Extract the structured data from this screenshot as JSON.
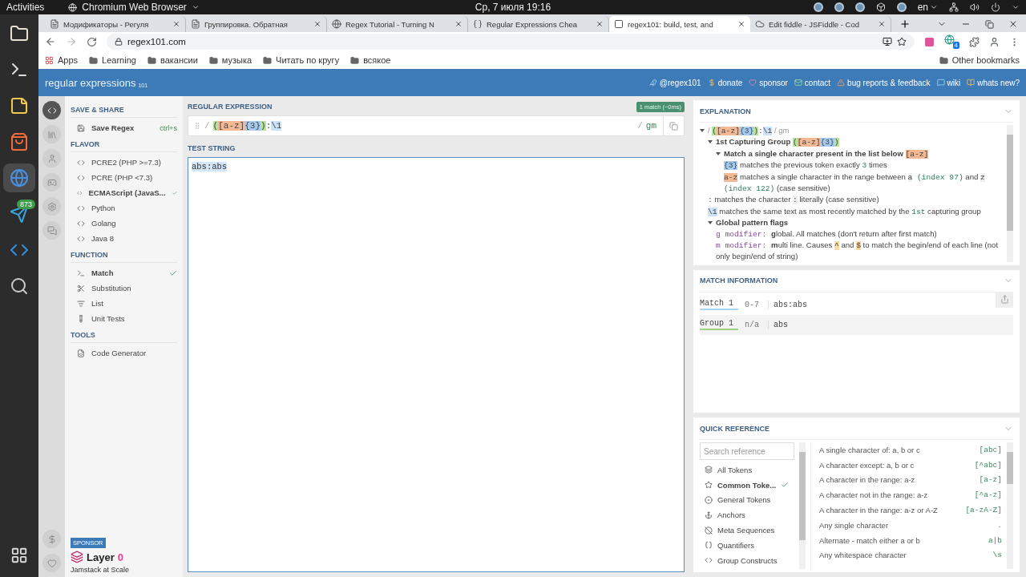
{
  "topbar": {
    "activities": "Activities",
    "app_menu": "Chromium Web Browser",
    "clock": "Ср, 7 июля  19:16",
    "language": "en"
  },
  "dock": {
    "items": [
      {
        "kind": "files",
        "selected": false
      },
      {
        "kind": "terminal",
        "selected": false
      },
      {
        "kind": "notes",
        "selected": false
      },
      {
        "kind": "store",
        "selected": false
      },
      {
        "kind": "browser",
        "selected": true
      },
      {
        "kind": "messenger",
        "selected": false,
        "badge": "873"
      },
      {
        "kind": "editor",
        "selected": false
      },
      {
        "kind": "viewer",
        "selected": false
      }
    ]
  },
  "browser": {
    "tabs": [
      {
        "kind": "doc",
        "title": "Модификаторы - Регуля",
        "selected": false
      },
      {
        "kind": "doc",
        "title": "Группировка. Обратная",
        "selected": false
      },
      {
        "kind": "globe",
        "title": "Regex Tutorial - Turning N",
        "selected": false
      },
      {
        "kind": "brackets",
        "title": "Regular Expressions Chea",
        "selected": false
      },
      {
        "kind": "site",
        "title": "regex101: build, test, and",
        "selected": true
      },
      {
        "kind": "cloud",
        "title": "Edit fiddle - JSFiddle - Cod",
        "selected": false
      }
    ],
    "address": "regex101.com",
    "extension_badge": "4",
    "bookmarks": [
      {
        "kind": "apps",
        "label": "Apps"
      },
      {
        "kind": "folder",
        "label": "Learning"
      },
      {
        "kind": "folder",
        "label": "вакансии"
      },
      {
        "kind": "folder",
        "label": "музыка"
      },
      {
        "kind": "folder",
        "label": "Читать по кругу"
      },
      {
        "kind": "folder",
        "label": "всякое"
      }
    ],
    "other_bookmarks": "Other bookmarks"
  },
  "site": {
    "logo": "regular expressions",
    "logo_suffix": "101",
    "links": [
      {
        "kind": "twitter",
        "label": "@regex101"
      },
      {
        "kind": "donate",
        "label": "donate"
      },
      {
        "kind": "sponsor",
        "label": "sponsor"
      },
      {
        "kind": "contact",
        "label": "contact"
      },
      {
        "kind": "bug",
        "label": "bug reports & feedback"
      },
      {
        "kind": "wiki",
        "label": "wiki"
      },
      {
        "kind": "news",
        "label": "whats new?"
      }
    ]
  },
  "rail": {
    "items": [
      {
        "kind": "editor",
        "selected": true
      },
      {
        "kind": "library",
        "selected": false
      },
      {
        "kind": "account",
        "selected": false
      },
      {
        "kind": "quiz",
        "selected": false
      },
      {
        "kind": "settings",
        "selected": false
      },
      {
        "kind": "chat",
        "selected": false
      }
    ],
    "bottom": [
      {
        "kind": "donate"
      },
      {
        "kind": "sponsor"
      }
    ]
  },
  "sidebar": {
    "sections": [
      {
        "title": "SAVE & SHARE",
        "items": [
          {
            "kind": "save",
            "label": "Save Regex",
            "shortcut": "ctrl+s"
          }
        ]
      },
      {
        "title": "FLAVOR",
        "items": [
          {
            "kind": "code",
            "label": "PCRE2 (PHP >=7.3)",
            "selected": false
          },
          {
            "kind": "code",
            "label": "PCRE (PHP <7.3)",
            "selected": false
          },
          {
            "kind": "code",
            "label": "ECMAScript (JavaS...",
            "selected": true
          },
          {
            "kind": "code",
            "label": "Python",
            "selected": false
          },
          {
            "kind": "code",
            "label": "Golang",
            "selected": false
          },
          {
            "kind": "code",
            "label": "Java 8",
            "selected": false
          }
        ]
      },
      {
        "title": "FUNCTION",
        "items": [
          {
            "kind": "match",
            "label": "Match",
            "selected": true
          },
          {
            "kind": "substitution",
            "label": "Substitution",
            "selected": false
          },
          {
            "kind": "list",
            "label": "List",
            "selected": false
          },
          {
            "kind": "tests",
            "label": "Unit Tests",
            "selected": false
          }
        ]
      },
      {
        "title": "TOOLS",
        "items": [
          {
            "kind": "file",
            "label": "Code Generator"
          }
        ]
      }
    ],
    "sponsor": {
      "badge": "SPONSOR",
      "brand": "Layer",
      "brand_suffix": "0",
      "tagline": "Jamstack at Scale"
    }
  },
  "regex": {
    "title": "REGULAR EXPRESSION",
    "status": "1 match (~0ms)",
    "delimiter": "/",
    "tokens": [
      {
        "text": "(",
        "color": "#b8e39d"
      },
      {
        "text": "[a-z]",
        "color": "#f3b994"
      },
      {
        "text": "{3}",
        "color": "#a6cbf0"
      },
      {
        "text": ")",
        "color": "#b8e39d"
      },
      {
        "text": ":"
      },
      {
        "text": "\\1",
        "color": "#cce3f7"
      }
    ],
    "closing_delimiter": "/",
    "flags": "gm"
  },
  "test_string": {
    "title": "TEST STRING",
    "value": "abs:abs"
  },
  "explanation": {
    "title": "EXPLANATION",
    "tree": {
      "expanded": true,
      "segments": [
        {
          "kind": "delim",
          "text": "/ "
        },
        {
          "kind": "token",
          "text": "(",
          "color": "#b8e39d"
        },
        {
          "kind": "token",
          "text": "[a-z]",
          "color": "#f3b994"
        },
        {
          "kind": "token",
          "text": "{3}",
          "color": "#a6cbf0"
        },
        {
          "kind": "token",
          "text": ")",
          "color": "#b8e39d"
        },
        {
          "kind": "code",
          "text": ":"
        },
        {
          "kind": "token",
          "text": "\\1",
          "color": "#cce3f7"
        },
        {
          "kind": "delim",
          "text": " / gm"
        }
      ],
      "children": [
        {
          "expanded": true,
          "segments": [
            {
              "kind": "bold",
              "text": "1st Capturing Group "
            },
            {
              "kind": "token",
              "text": "(",
              "color": "#b8e39d"
            },
            {
              "kind": "token",
              "text": "[a-z]",
              "color": "#f3b994"
            },
            {
              "kind": "token",
              "text": "{3}",
              "color": "#a6cbf0"
            },
            {
              "kind": "token",
              "text": ")",
              "color": "#b8e39d"
            }
          ],
          "children": [
            {
              "expanded": true,
              "segments": [
                {
                  "kind": "bold",
                  "text": "Match a single character present in the list below "
                },
                {
                  "kind": "token",
                  "text": "[a-z]",
                  "color": "#f3b994"
                }
              ],
              "children": [
                {
                  "segments": [
                    {
                      "kind": "token",
                      "text": "{3}",
                      "color": "#a6cbf0"
                    },
                    {
                      "kind": "text",
                      "text": " matches the previous token exactly "
                    },
                    {
                      "kind": "mono",
                      "text": "3"
                    },
                    {
                      "kind": "text",
                      "text": " times"
                    }
                  ]
                },
                {
                  "segments": [
                    {
                      "kind": "token",
                      "text": "a-z",
                      "color": "#f3b994"
                    },
                    {
                      "kind": "text",
                      "text": " matches a single character in the range between "
                    },
                    {
                      "kind": "char",
                      "text": "a"
                    },
                    {
                      "kind": "mono",
                      "text": " (index 97)"
                    },
                    {
                      "kind": "text",
                      "text": " and "
                    },
                    {
                      "kind": "char",
                      "text": "z"
                    },
                    {
                      "kind": "mono",
                      "text": " (index 122)"
                    },
                    {
                      "kind": "text",
                      "text": " (case sensitive)"
                    }
                  ]
                }
              ]
            }
          ]
        },
        {
          "segments": [
            {
              "kind": "code",
              "text": ":"
            },
            {
              "kind": "text",
              "text": " matches the character "
            },
            {
              "kind": "char",
              "text": ":"
            },
            {
              "kind": "text",
              "text": " literally (case sensitive)"
            }
          ]
        },
        {
          "segments": [
            {
              "kind": "token",
              "text": "\\1",
              "color": "#cce3f7"
            },
            {
              "kind": "text",
              "text": " matches the same text as most recently matched by the "
            },
            {
              "kind": "mono",
              "text": "1st"
            },
            {
              "kind": "text",
              "text": " capturing group"
            }
          ]
        },
        {
          "expanded": true,
          "segments": [
            {
              "kind": "bold",
              "text": "Global pattern flags"
            }
          ],
          "children": [
            {
              "segments": [
                {
                  "kind": "flag",
                  "text": "g modifier: "
                },
                {
                  "kind": "bold",
                  "text": "g"
                },
                {
                  "kind": "text",
                  "text": "lobal. All matches (don't return after first match)"
                }
              ]
            },
            {
              "segments": [
                {
                  "kind": "flag",
                  "text": "m modifier: "
                },
                {
                  "kind": "bold",
                  "text": "m"
                },
                {
                  "kind": "text",
                  "text": "ulti line. Causes "
                },
                {
                  "kind": "token",
                  "text": "^",
                  "color": "#fbd9a0"
                },
                {
                  "kind": "text",
                  "text": " and "
                },
                {
                  "kind": "token",
                  "text": "$",
                  "color": "#fbd9a0"
                },
                {
                  "kind": "text",
                  "text": " to match the begin/end of each line (not only begin/end of string)"
                }
              ]
            }
          ]
        }
      ]
    }
  },
  "match_info": {
    "title": "MATCH INFORMATION",
    "rows": [
      {
        "label": "Match 1",
        "range": "0-7",
        "value": "abs:abs",
        "color": "#a9d4f2"
      },
      {
        "label": "Group 1",
        "range": "n/a",
        "value": "abs",
        "color": "#9ed47f"
      }
    ]
  },
  "quick_reference": {
    "title": "QUICK REFERENCE",
    "search_placeholder": "Search reference",
    "categories": [
      {
        "kind": "all",
        "label": "All Tokens",
        "selected": false
      },
      {
        "kind": "common",
        "label": "Common Toke...",
        "selected": true
      },
      {
        "kind": "general",
        "label": "General Tokens",
        "selected": false
      },
      {
        "kind": "anchors",
        "label": "Anchors",
        "selected": false
      },
      {
        "kind": "meta",
        "label": "Meta Sequences",
        "selected": false
      },
      {
        "kind": "quantifiers",
        "label": "Quantifiers",
        "selected": false
      },
      {
        "kind": "groups",
        "label": "Group Constructs",
        "selected": false
      }
    ],
    "items": [
      {
        "description": "A single character of: a, b or c",
        "token": "[abc]"
      },
      {
        "description": "A character except: a, b or c",
        "token": "[^abc]"
      },
      {
        "description": "A character in the range: a-z",
        "token": "[a-z]"
      },
      {
        "description": "A character not in the range: a-z",
        "token": "[^a-z]"
      },
      {
        "description": "A character in the range: a-z or A-Z",
        "token": "[a-zA-Z]"
      },
      {
        "description": "Any single character",
        "token": "."
      },
      {
        "description": "Alternate - match either a or b",
        "token": "a|b"
      },
      {
        "description": "Any whitespace character",
        "token": "\\s"
      }
    ]
  }
}
